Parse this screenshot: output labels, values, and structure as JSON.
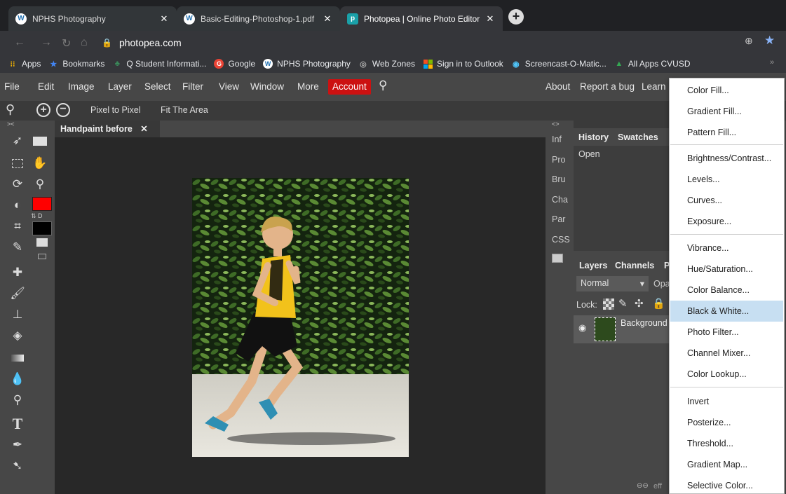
{
  "browser": {
    "tabs": [
      {
        "title": "NPHS Photography",
        "favicon": "wordpress-icon",
        "active": false
      },
      {
        "title": "Basic-Editing-Photoshop-1.pdf",
        "favicon": "wordpress-icon",
        "active": false
      },
      {
        "title": "Photopea | Online Photo Editor",
        "favicon": "photopea-icon",
        "active": true
      }
    ],
    "close_glyph": "✕",
    "new_tab_glyph": "+",
    "url": "photopea.com",
    "bookmarks": [
      {
        "label": "Apps",
        "icon": "apps-grid-icon"
      },
      {
        "label": "Bookmarks",
        "icon": "star-icon"
      },
      {
        "label": "Q Student Informati...",
        "icon": "q-icon"
      },
      {
        "label": "Google",
        "icon": "google-icon"
      },
      {
        "label": "NPHS Photography",
        "icon": "wordpress-icon"
      },
      {
        "label": "Web Zones",
        "icon": "globe-icon"
      },
      {
        "label": "Sign in to Outlook",
        "icon": "windows-icon"
      },
      {
        "label": "Screencast-O-Matic...",
        "icon": "record-icon"
      },
      {
        "label": "All Apps CVUSD",
        "icon": "drive-icon"
      }
    ],
    "bookmarks_more": "»"
  },
  "photopea": {
    "menu": [
      "File",
      "Edit",
      "Image",
      "Layer",
      "Select",
      "Filter",
      "View",
      "Window",
      "More"
    ],
    "account_label": "Account",
    "right_menu": [
      "About",
      "Report a bug",
      "Learn"
    ],
    "options": {
      "pixel_to_pixel": "Pixel to Pixel",
      "fit_area": "Fit The Area"
    },
    "document_tab": "Handpaint before",
    "document_tab_close": "✕",
    "side_labels": [
      "Inf",
      "Pro",
      "Bru",
      "Cha",
      "Par",
      "CSS"
    ],
    "collapse_glyph": "<>",
    "collapse_glyph2": "><",
    "history_tabs": [
      "History",
      "Swatches"
    ],
    "history_items": [
      "Open"
    ],
    "layers_tabs": [
      "Layers",
      "Channels",
      "P"
    ],
    "blend_mode": "Normal",
    "opacity_label": "Opa",
    "lock_label": "Lock:",
    "layer_name": "Background",
    "footer_label": "eff",
    "colors": {
      "foreground": "#ff0000",
      "background": "#000000",
      "accent": "#cc1111",
      "highlight": "#c7dff2"
    }
  },
  "dropdown": {
    "groups": [
      [
        "Color Fill...",
        "Gradient Fill...",
        "Pattern Fill..."
      ],
      [
        "Brightness/Contrast...",
        "Levels...",
        "Curves...",
        "Exposure..."
      ],
      [
        "Vibrance...",
        "Hue/Saturation...",
        "Color Balance...",
        "Black & White...",
        "Photo Filter...",
        "Channel Mixer...",
        "Color Lookup..."
      ],
      [
        "Invert",
        "Posterize...",
        "Threshold...",
        "Gradient Map...",
        "Selective Color..."
      ]
    ],
    "highlighted": "Black & White..."
  }
}
